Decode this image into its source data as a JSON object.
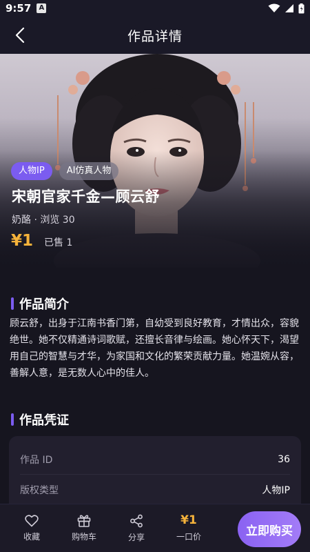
{
  "status_bar": {
    "time": "9:57",
    "notification_glyph": "A"
  },
  "header": {
    "title": "作品详情"
  },
  "work": {
    "tags": [
      "人物IP",
      "AI仿真人物"
    ],
    "title": "宋朝官家千金—顾云舒",
    "meta": "奶酪 · 浏览 30",
    "price": "¥1",
    "sold": "已售 1"
  },
  "intro": {
    "heading": "作品简介",
    "text": "顾云舒，出身于江南书香门第，自幼受到良好教育，才情出众，容貌绝世。她不仅精通诗词歌赋，还擅长音律与绘画。她心怀天下，渴望用自己的智慧与才华，为家国和文化的繁荣贡献力量。她温婉从容，善解人意，是无数人心中的佳人。"
  },
  "certificate": {
    "heading": "作品凭证",
    "rows": [
      {
        "label": "作品 ID",
        "value": "36"
      },
      {
        "label": "版权类型",
        "value": "人物IP"
      }
    ]
  },
  "bottom_bar": {
    "favorite_label": "收藏",
    "cart_label": "购物车",
    "share_label": "分享",
    "price": "¥1",
    "price_label": "一口价",
    "buy_label": "立即购买"
  },
  "colors": {
    "accent": "#7b5cf0",
    "price": "#f6b33b",
    "background": "#16151f"
  },
  "icons": [
    "back-arrow-icon",
    "wifi-icon",
    "signal-icon",
    "battery-icon",
    "heart-icon",
    "gift-icon",
    "share-icon"
  ]
}
